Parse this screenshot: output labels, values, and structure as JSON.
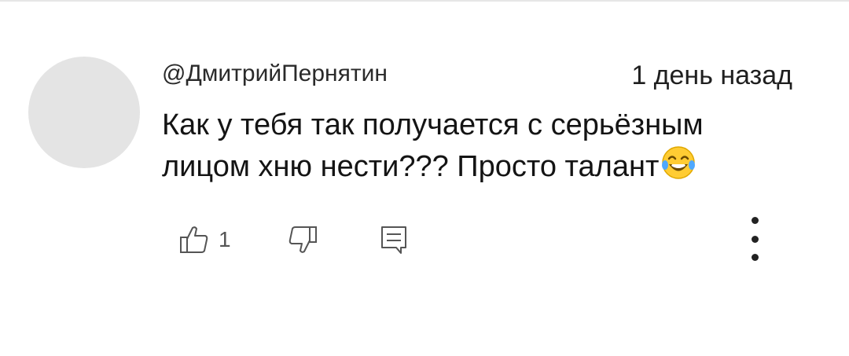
{
  "comment": {
    "author": "@ДмитрийПернятин",
    "timestamp": "1 день назад",
    "text_line1": "Как у тебя так получается с серьёзным",
    "text_line2": "лицом хню нести??? Просто талант",
    "emoji": "tears-of-joy-emoji"
  },
  "actions": {
    "like_count": "1",
    "like_icon": "thumbs-up-icon",
    "dislike_icon": "thumbs-down-icon",
    "reply_icon": "reply-comment-icon",
    "more_icon": "more-vertical-icon"
  },
  "colors": {
    "avatar": "#e4e4e4",
    "text": "#141414",
    "icon": "#555555"
  }
}
